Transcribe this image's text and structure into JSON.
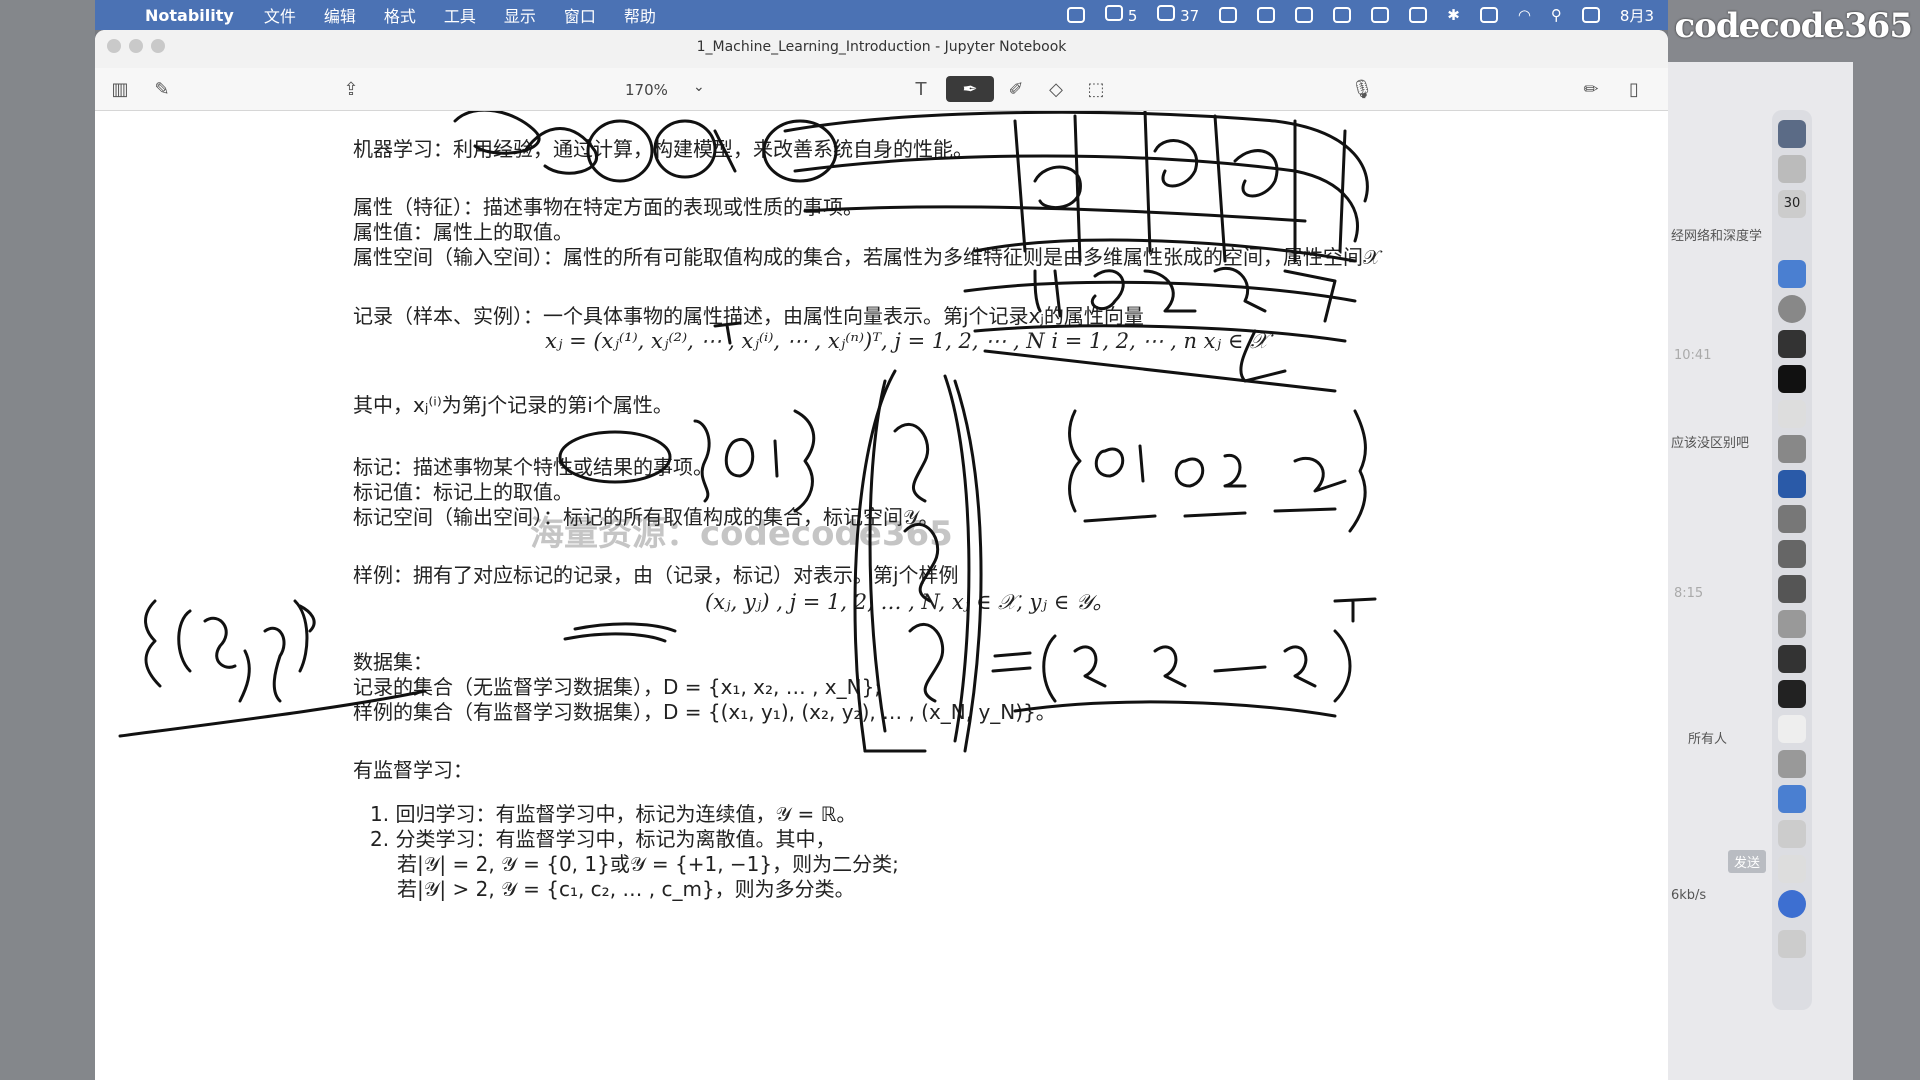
{
  "menubar": {
    "app_name": "Notability",
    "items": [
      "文件",
      "编辑",
      "格式",
      "工具",
      "显示",
      "窗口",
      "帮助"
    ],
    "wechat_count": "5",
    "notif_count": "37",
    "date": "8月3"
  },
  "brand": "codecode365",
  "window": {
    "title": "1_Machine_Learning_Introduction - Jupyter Notebook",
    "zoom": "170%"
  },
  "note": {
    "line1": "机器学习：利用经验，通过计算，构建模型，来改善系统自身的性能。",
    "attr1": "属性（特征）：描述事物在特定方面的表现或性质的事项。",
    "attr2": "属性值：属性上的取值。",
    "attr3": "属性空间（输入空间）：属性的所有可能取值构成的集合，若属性为多维特征则是由多维属性张成的空间，属性空间𝒳",
    "rec1": "记录（样本、实例）：一个具体事物的属性描述，由属性向量表示。第j个记录xⱼ的属性向量",
    "rec_formula": "xⱼ = (xⱼ⁽¹⁾, xⱼ⁽²⁾, ⋯ , xⱼ⁽ⁱ⁾, ⋯ , xⱼ⁽ⁿ⁾)ᵀ,      j = 1, 2, ⋯ , N     i = 1, 2, ⋯ , n     xⱼ ∈ 𝒳",
    "rec2": "其中，xⱼ⁽ⁱ⁾为第j个记录的第i个属性。",
    "label1": "标记：描述事物某个特性或结果的事项。",
    "label2": "标记值：标记上的取值。",
    "label3": "标记空间（输出空间）：标记的所有取值构成的集合，标记空间𝒴。",
    "ex1": "样例：拥有了对应标记的记录，由（记录，标记）对表示。第j个样例",
    "ex_formula": "(xⱼ, yⱼ) ,     j = 1, 2, … , N,     xⱼ ∈ 𝒳, yⱼ ∈ 𝒴。",
    "ds0": "数据集：",
    "ds1": "记录的集合（无监督学习数据集），D = {x₁, x₂, … , x_N};",
    "ds2": "样例的集合（有监督学习数据集），D = {(x₁, y₁), (x₂, y₂), … , (x_N, y_N)}。",
    "sup0": "有监督学习：",
    "sup1": "1. 回归学习：有监督学习中，标记为连续值，𝒴 = ℝ。",
    "sup2": "2. 分类学习：有监督学习中，标记为离散值。其中，",
    "sup3": "若|𝒴| = 2, 𝒴 = {0, 1}或𝒴 = {+1, −1}，则为二分类;",
    "sup4": "若|𝒴| > 2, 𝒴 = {c₁, c₂, … , c_m}，则为多分类。"
  },
  "watermark": "海量资源：codecode365",
  "side_app": {
    "text1": "经网络和深度学",
    "text2": "应该没区别吧",
    "text3": "所有人",
    "text4": "发送",
    "text5": "6kb/s",
    "time1": "10:41",
    "time2": "8:15",
    "badge": "30"
  }
}
